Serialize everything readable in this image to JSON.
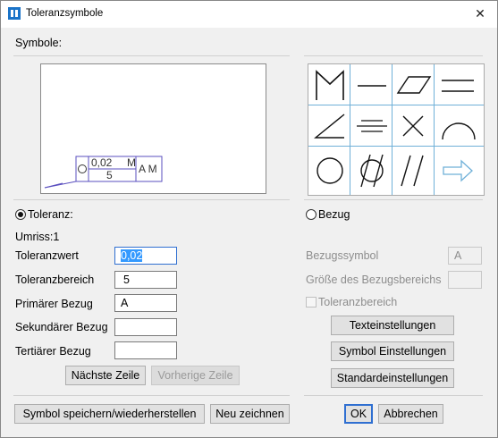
{
  "window": {
    "title": "Toleranzsymbole",
    "close_glyph": "✕"
  },
  "symbols_label": "Symbole:",
  "preview": {
    "tolerance_value": "0,02",
    "modifier": "M",
    "second_value": "5",
    "datums": "A M"
  },
  "symbol_grid": [
    "maximum-material-icon",
    "straightness-icon",
    "flatness-icon",
    "parallelism-icon",
    "angularity-icon",
    "symmetry-icon",
    "cross-icon",
    "profile-line-icon",
    "circularity-icon",
    "cylindricity-icon",
    "total-runout-icon",
    "arrow-icon"
  ],
  "toleranz": {
    "radio_label": "Toleranz:",
    "umriss": "Umriss:1",
    "fields": [
      {
        "label": "Toleranzwert",
        "value": "0,02"
      },
      {
        "label": "Toleranzbereich",
        "value": "5"
      },
      {
        "label": "Primärer Bezug",
        "value": "A"
      },
      {
        "label": "Sekundärer Bezug",
        "value": ""
      },
      {
        "label": "Tertiärer Bezug",
        "value": ""
      }
    ],
    "next_row": "Nächste Zeile",
    "prev_row": "Vorherige Zeile"
  },
  "bezug": {
    "radio_label": "Bezug",
    "symbol_label": "Bezugssymbol",
    "symbol_value": "A",
    "size_label": "Größe des Bezugsbereichs",
    "size_value": "",
    "range_label": "Toleranzbereich",
    "text_settings": "Texteinstellungen",
    "symbol_settings": "Symbol Einstellungen",
    "defaults": "Standardeinstellungen"
  },
  "footer": {
    "save_restore": "Symbol speichern/wiederherstellen",
    "redraw": "Neu zeichnen",
    "ok": "OK",
    "cancel": "Abbrechen"
  },
  "colors": {
    "accent": "#2f6fd1",
    "symbol_frame": "#5a4fbf",
    "grid_line": "#6fb0d8",
    "arrow": "#6fb0d8"
  }
}
